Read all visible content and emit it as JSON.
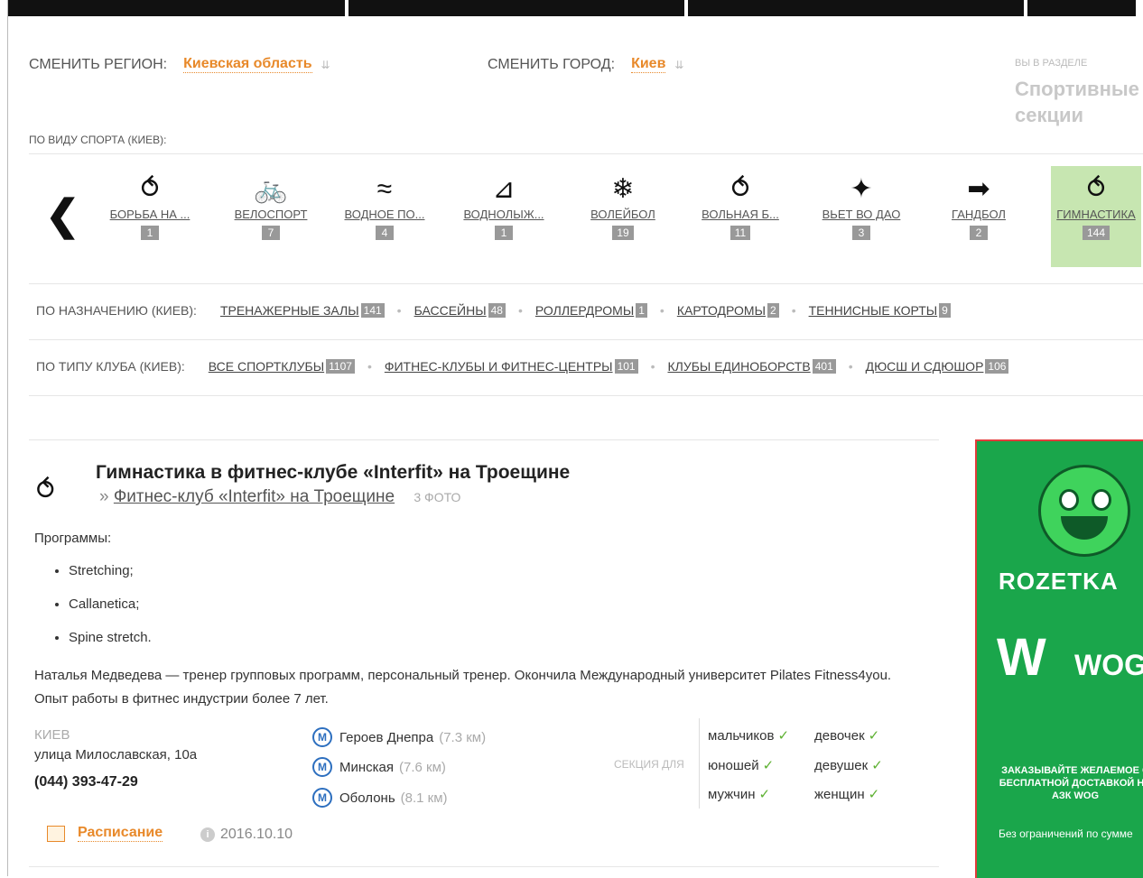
{
  "region": {
    "label": "СМЕНИТЬ РЕГИОН:",
    "value": "Киевская область"
  },
  "city": {
    "label": "СМЕНИТЬ ГОРОД:",
    "value": "Киев"
  },
  "section": {
    "label": "ВЫ В РАЗДЕЛЕ",
    "name": "Спортивные секции"
  },
  "sports_heading": "ПО ВИДУ СПОРТА (КИЕВ):",
  "sports": [
    {
      "name": "БОРЬБА НА ...",
      "count": "1",
      "icon": "wrestling-icon"
    },
    {
      "name": "ВЕЛОСПОРТ",
      "count": "7",
      "icon": "cycling-icon"
    },
    {
      "name": "ВОДНОЕ ПО...",
      "count": "4",
      "icon": "swimming-icon"
    },
    {
      "name": "ВОДНОЛЫЖ...",
      "count": "1",
      "icon": "waterski-icon"
    },
    {
      "name": "ВОЛЕЙБОЛ",
      "count": "19",
      "icon": "volleyball-icon"
    },
    {
      "name": "ВОЛЬНАЯ Б...",
      "count": "11",
      "icon": "freestyle-wrestling-icon"
    },
    {
      "name": "ВЬЕТ ВО ДАО",
      "count": "3",
      "icon": "martial-arts-icon"
    },
    {
      "name": "ГАНДБОЛ",
      "count": "2",
      "icon": "handball-icon"
    },
    {
      "name": "ГИМНАСТИКА",
      "count": "144",
      "icon": "gymnastics-icon"
    }
  ],
  "purpose": {
    "label": "ПО НАЗНАЧЕНИЮ (КИЕВ):",
    "items": [
      {
        "name": "ТРЕНАЖЕРНЫЕ ЗАЛЫ",
        "count": "141"
      },
      {
        "name": "БАССЕЙНЫ",
        "count": "48"
      },
      {
        "name": "РОЛЛЕРДРОМЫ",
        "count": "1"
      },
      {
        "name": "КАРТОДРОМЫ",
        "count": "2"
      },
      {
        "name": "ТЕННИСНЫЕ КОРТЫ",
        "count": "9"
      }
    ]
  },
  "club_type": {
    "label": "ПО ТИПУ КЛУБА (КИЕВ):",
    "items": [
      {
        "name": "ВСЕ СПОРТКЛУБЫ",
        "count": "1107"
      },
      {
        "name": "ФИТНЕС-КЛУБЫ И ФИТНЕС-ЦЕНТРЫ",
        "count": "101"
      },
      {
        "name": "КЛУБЫ ЕДИНОБОРСТВ",
        "count": "401"
      },
      {
        "name": "ДЮСШ И СДЮШОР",
        "count": "106"
      }
    ]
  },
  "card": {
    "title": "Гимнастика в фитнес-клубе «Interfit» на Троещине",
    "club_prefix": "»",
    "club_link": "Фитнес-клуб «Interfit» на Троещине",
    "photos": "3 ФОТО",
    "programs_label": "Программы:",
    "programs": [
      "Stretching;",
      "Callanetica;",
      "Spine stretch."
    ],
    "description": "Наталья Медведева — тренер групповых программ, персональный тренер. Окончила Международный университет Pilates Fitness4you. Опыт работы в фитнес индустрии более 7 лет.",
    "city": "КИЕВ",
    "address": "улица Милославская, 10а",
    "phone": "(044) 393-47-29",
    "metro": [
      {
        "station": "Героев Днепра",
        "distance": "(7.3 км)"
      },
      {
        "station": "Минская",
        "distance": "(7.6 км)"
      },
      {
        "station": "Оболонь",
        "distance": "(8.1 км)"
      }
    ],
    "metro_symbol": "М",
    "section_for": "СЕКЦИЯ ДЛЯ",
    "genders": [
      [
        "мальчиков",
        "девочек"
      ],
      [
        "юношей",
        "девушек"
      ],
      [
        "мужчин",
        "женщин"
      ]
    ],
    "check": "✓",
    "schedule": "Расписание",
    "date": "2016.10.10"
  },
  "ad": {
    "brand": "ROZETKA",
    "partner": "WOG",
    "slogan": "ЗАКАЗЫВАЙТЕ ЖЕЛАЕМОЕ С БЕСПЛАТНОЙ ДОСТАВКОЙ НА АЗК WOG",
    "small": "Без ограничений по сумме"
  },
  "colors": {
    "accent": "#e8892a",
    "active": "#c7e6b1",
    "badge": "#999999",
    "ad_bg": "#1aa64b"
  }
}
